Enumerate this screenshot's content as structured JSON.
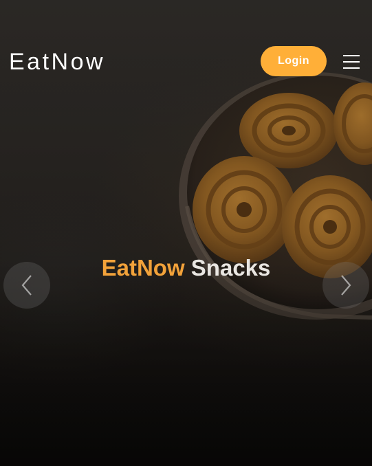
{
  "header": {
    "brand": "EatNow",
    "login_label": "Login",
    "menu_icon": "hamburger-menu-icon"
  },
  "hero": {
    "headline_brand": "EatNow",
    "headline_rest": "Snacks",
    "prev_icon": "chevron-left-icon",
    "next_icon": "chevron-right-icon"
  },
  "colors": {
    "accent": "#ffaf38",
    "headline_accent": "#f2a23a",
    "background": "#1b1815"
  }
}
